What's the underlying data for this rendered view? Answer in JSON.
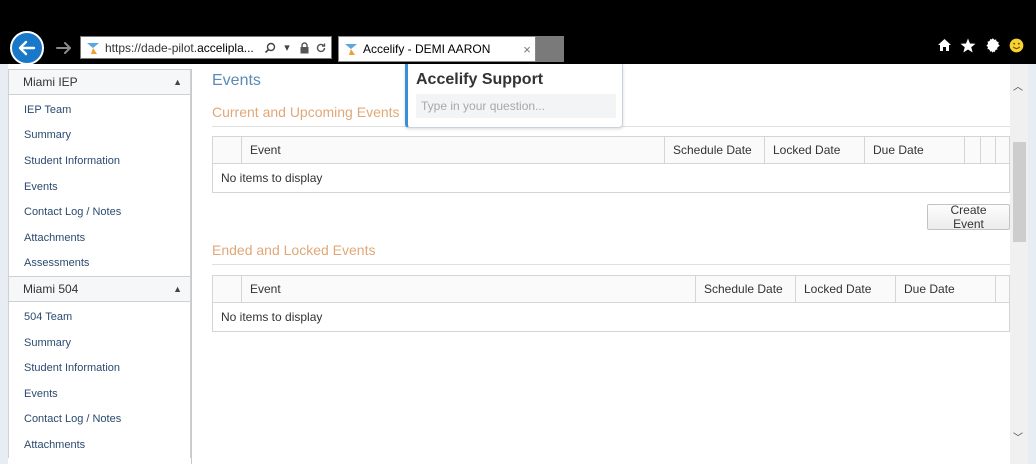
{
  "browser": {
    "url_dim": "https://dade-pilot.",
    "url_strong": "accelipla...",
    "tab_title": "Accelify - DEMI AARON",
    "tab_close": "×",
    "colors": {
      "back_button": "#1a78c8",
      "tab_new": "#7a7a7a"
    }
  },
  "sidebar": {
    "panels": [
      {
        "title": "Miami IEP",
        "items": [
          "IEP Team",
          "Summary",
          "Student Information",
          "Events",
          "Contact Log / Notes",
          "Attachments",
          "Assessments"
        ]
      },
      {
        "title": "Miami 504",
        "items": [
          "504 Team",
          "Summary",
          "Student Information",
          "Events",
          "Contact Log / Notes",
          "Attachments"
        ]
      }
    ]
  },
  "main": {
    "title": "Events",
    "current_section": {
      "title": "Current and Upcoming Events",
      "columns": [
        "Event",
        "Schedule Date",
        "Locked Date",
        "Due Date"
      ],
      "empty_text": "No items to display",
      "button": "Create Event"
    },
    "ended_section": {
      "title": "Ended and Locked Events",
      "columns": [
        "Event",
        "Schedule Date",
        "Locked Date",
        "Due Date"
      ],
      "empty_text": "No items to display"
    }
  },
  "support": {
    "title": "Accelify Support",
    "placeholder": "Type in your question..."
  },
  "colors": {
    "page_title": "#5a8ab5",
    "section_title": "#e0a878",
    "nav_link": "#2b4a6e",
    "support_accent": "#3a8fd4"
  }
}
